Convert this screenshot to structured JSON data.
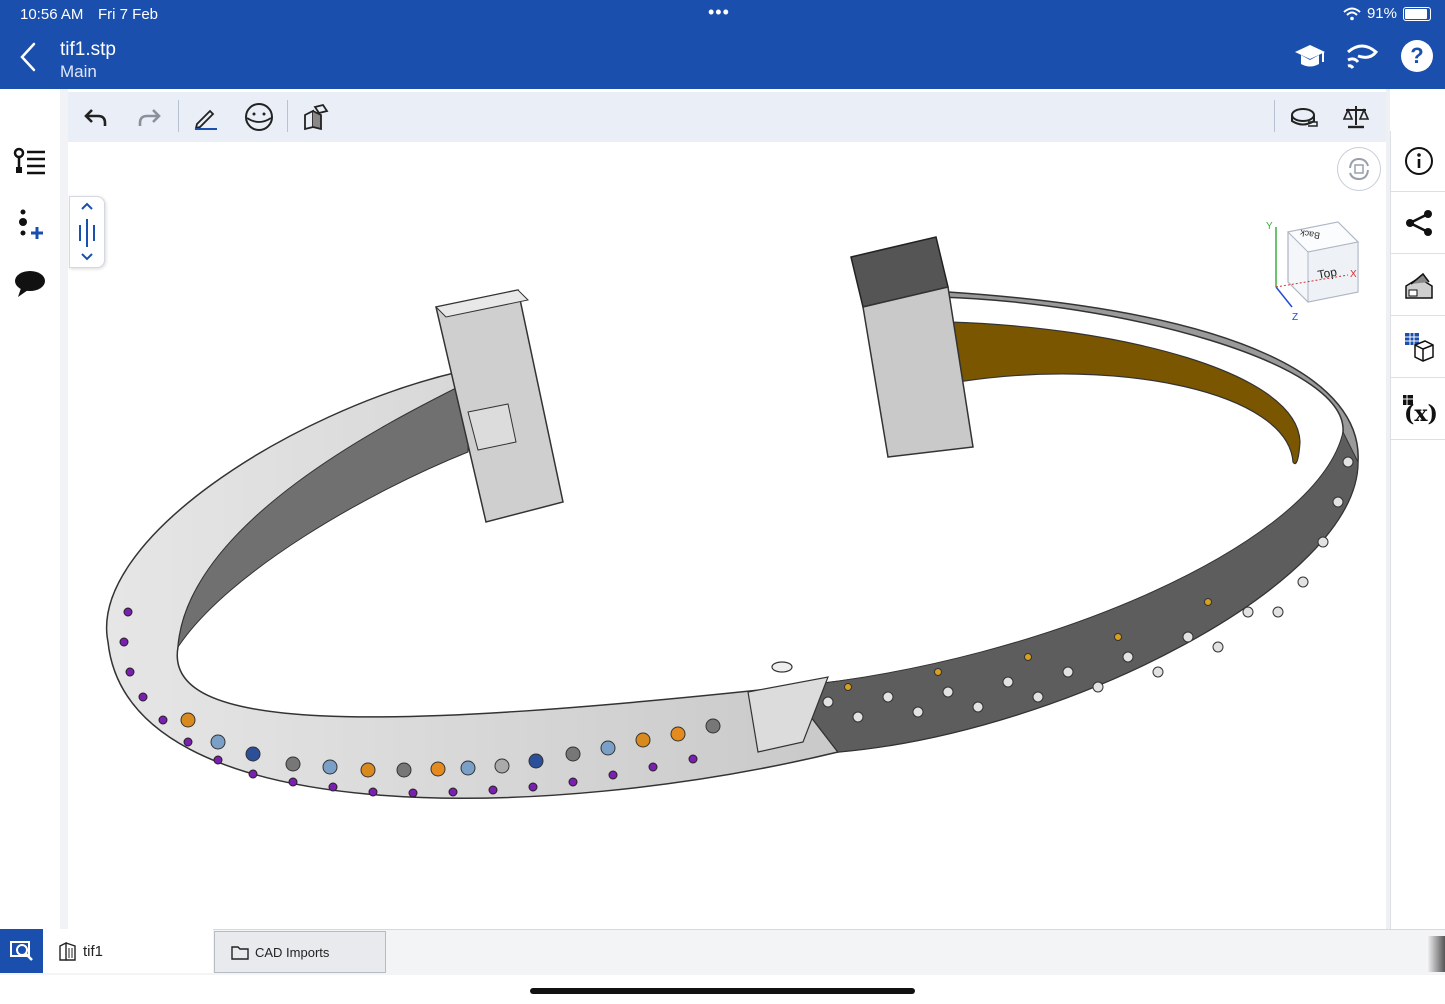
{
  "status_bar": {
    "time": "10:56 AM",
    "date": "Fri 7 Feb",
    "dots": "•••",
    "battery_text": "91%",
    "battery_level": 0.91
  },
  "header": {
    "title": "tif1.stp",
    "subtitle": "Main",
    "icons": [
      "back-chevron-icon",
      "learning-center-icon",
      "connect-icon",
      "help-icon"
    ]
  },
  "toolbar": {
    "icons": [
      "undo-icon",
      "redo-icon",
      "sketch-pencil-icon",
      "plane-icon",
      "parts-icon",
      "measure-tape-icon",
      "mass-properties-icon"
    ]
  },
  "left_rail": {
    "icons": [
      "feature-list-icon",
      "add-mate-icon",
      "comments-icon"
    ]
  },
  "right_rail": {
    "icons": [
      "info-icon",
      "share-icon",
      "appearance-icon",
      "configurations-icon",
      "variables-icon"
    ]
  },
  "view_cube": {
    "top_face": "Top",
    "back_face": "Back",
    "axis_x": "X",
    "axis_y": "Y",
    "axis_z": "Z"
  },
  "bottom_tabs": {
    "part_tab": "tif1",
    "folder_tab": "CAD Imports"
  },
  "colors": {
    "brand_blue": "#1a4fad",
    "toolbar_bg": "#e9eef7",
    "metal_gray": "#c8c8c8",
    "inner_gold": "#7a5600",
    "gem_purple": "#7a1fb0"
  }
}
